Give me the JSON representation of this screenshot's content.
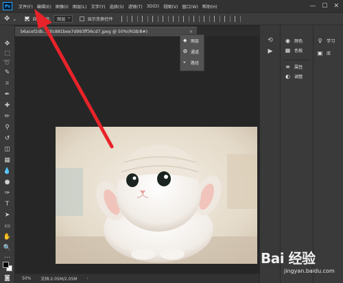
{
  "menubar": {
    "logo": "Ps",
    "items": [
      "文件(F)",
      "编辑(E)",
      "图像(I)",
      "图层(L)",
      "文字(Y)",
      "选择(S)",
      "滤镜(T)",
      "3D(D)",
      "视图(V)",
      "窗口(W)",
      "帮助(H)"
    ],
    "window_controls": [
      "—",
      "☐",
      "✕"
    ]
  },
  "options": {
    "auto_select_label": "自动选择:",
    "auto_select_target": "图层",
    "show_transform_label": "显示变换控件"
  },
  "document": {
    "tab_title": "b6acef2db...d0c881bee7d993ff36cd7.jpeg @ 50%(RGB/8#)",
    "close": "×"
  },
  "mini_panel": {
    "items": [
      {
        "icon": "layers-icon",
        "label": "图层"
      },
      {
        "icon": "channels-icon",
        "label": "通道"
      },
      {
        "icon": "paths-icon",
        "label": "路径"
      }
    ]
  },
  "dock": {
    "panels": [
      {
        "icon": "color-icon",
        "label": "颜色"
      },
      {
        "icon": "swatches-icon",
        "label": "色板"
      },
      {
        "icon": "properties-icon",
        "label": "属性"
      },
      {
        "icon": "adjustments-icon",
        "label": "调整"
      }
    ],
    "learn": [
      {
        "icon": "learn-icon",
        "label": "学习"
      },
      {
        "icon": "libraries-icon",
        "label": "库"
      }
    ]
  },
  "status": {
    "zoom": "50%",
    "doc_size": "文档:2.05M/2.05M"
  },
  "watermark": {
    "brand": "Bai 经验",
    "url": "jingyan.baidu.com"
  },
  "colors": {
    "arrow": "#e8232a",
    "ps_blue": "#31a8ff"
  }
}
